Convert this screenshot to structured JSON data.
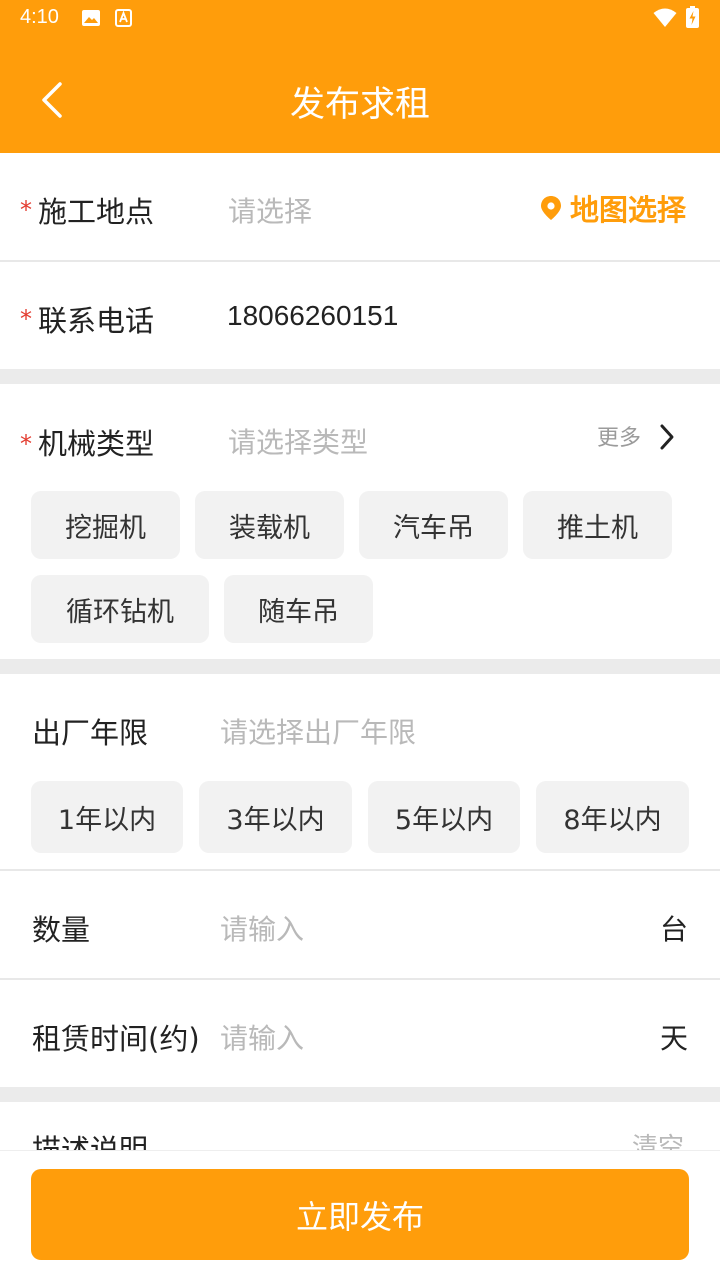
{
  "status_bar": {
    "time": "4:10"
  },
  "header": {
    "title": "发布求租"
  },
  "form": {
    "site": {
      "label": "施工地点",
      "placeholder": "请选择",
      "map_label": "地图选择"
    },
    "phone": {
      "label": "联系电话",
      "value": "18066260151"
    },
    "machine": {
      "label": "机械类型",
      "placeholder": "请选择类型",
      "more": "更多",
      "options": [
        "挖掘机",
        "装载机",
        "汽车吊",
        "推土机",
        "循环钻机",
        "随车吊"
      ]
    },
    "age": {
      "label": "出厂年限",
      "placeholder": "请选择出厂年限",
      "options": [
        "1年以内",
        "3年以内",
        "5年以内",
        "8年以内"
      ]
    },
    "quantity": {
      "label": "数量",
      "placeholder": "请输入",
      "unit": "台"
    },
    "duration": {
      "label": "租赁时间(约)",
      "placeholder": "请输入",
      "unit": "天"
    },
    "description": {
      "label": "描述说明",
      "clear": "清空"
    }
  },
  "footer": {
    "publish_label": "立即发布"
  },
  "colors": {
    "accent": "#ff9d0b",
    "required": "#e33b2f"
  }
}
